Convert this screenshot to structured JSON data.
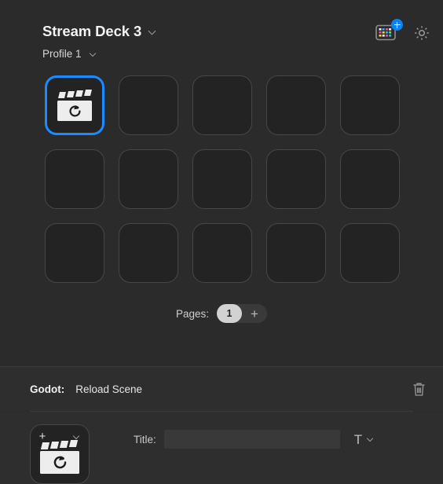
{
  "header": {
    "app_title": "Stream Deck 3",
    "profile_label": "Profile 1",
    "title_chevron_icon": "chevron-down-icon",
    "profile_chevron_icon": "chevron-down-icon",
    "add_device_icon": "stream-deck-device-add-icon",
    "settings_icon": "gear-icon"
  },
  "keys": [
    {
      "index": 0,
      "selected": true,
      "icon": "clapperboard-reload-icon",
      "label": ""
    },
    {
      "index": 1,
      "selected": false,
      "icon": "",
      "label": ""
    },
    {
      "index": 2,
      "selected": false,
      "icon": "",
      "label": ""
    },
    {
      "index": 3,
      "selected": false,
      "icon": "",
      "label": ""
    },
    {
      "index": 4,
      "selected": false,
      "icon": "",
      "label": ""
    },
    {
      "index": 5,
      "selected": false,
      "icon": "",
      "label": ""
    },
    {
      "index": 6,
      "selected": false,
      "icon": "",
      "label": ""
    },
    {
      "index": 7,
      "selected": false,
      "icon": "",
      "label": ""
    },
    {
      "index": 8,
      "selected": false,
      "icon": "",
      "label": ""
    },
    {
      "index": 9,
      "selected": false,
      "icon": "",
      "label": ""
    },
    {
      "index": 10,
      "selected": false,
      "icon": "",
      "label": ""
    },
    {
      "index": 11,
      "selected": false,
      "icon": "",
      "label": ""
    },
    {
      "index": 12,
      "selected": false,
      "icon": "",
      "label": ""
    },
    {
      "index": 13,
      "selected": false,
      "icon": "",
      "label": ""
    },
    {
      "index": 14,
      "selected": false,
      "icon": "",
      "label": ""
    }
  ],
  "pages": {
    "label": "Pages:",
    "current": "1",
    "add_label": "+"
  },
  "action": {
    "plugin": "Godot:",
    "name": "Reload Scene",
    "delete_icon": "trash-icon"
  },
  "inspector": {
    "thumbnail_icon": "clapperboard-reload-icon",
    "thumbnail_add_label": "+",
    "thumbnail_chevron_icon": "chevron-down-icon",
    "title_label": "Title:",
    "title_value": "",
    "title_placeholder": "",
    "font_glyph": "T",
    "font_chevron_icon": "chevron-down-icon"
  },
  "colors": {
    "accent": "#1a8cff",
    "badge": "#1080f0",
    "background": "#2b2b2b",
    "panel": "#2e2e2e",
    "key": "#232323",
    "key_border": "#474747"
  }
}
